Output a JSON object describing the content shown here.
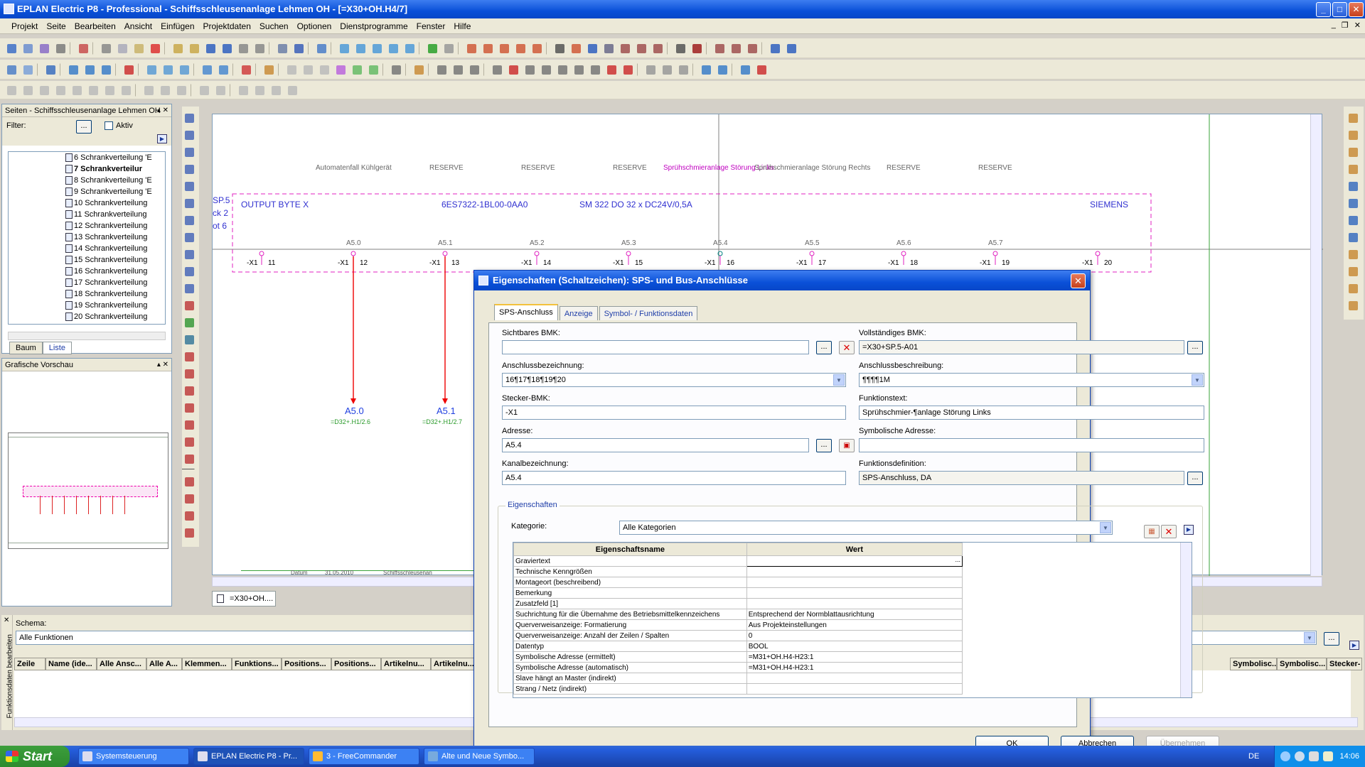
{
  "window": {
    "title": "EPLAN Electric P8 - Professional - Schiffsschleusenanlage Lehmen OH - [=X30+OH.H4/7]",
    "minimize": "_",
    "maximize": "□",
    "close": "✕"
  },
  "menu": [
    "Projekt",
    "Seite",
    "Bearbeiten",
    "Ansicht",
    "Einfügen",
    "Projektdaten",
    "Suchen",
    "Optionen",
    "Dienstprogramme",
    "Fenster",
    "Hilfe"
  ],
  "pages_panel": {
    "title": "Seiten - Schiffsschleusenanlage Lehmen OH",
    "filter_label": "Filter:",
    "filter_btn": "...",
    "aktiv_label": "Aktiv",
    "items": [
      "6 Schrankverteilung 'E",
      "7 Schrankverteilur",
      "8 Schrankverteilung 'E",
      "9 Schrankverteilung 'E",
      "10 Schrankverteilung",
      "11 Schrankverteilung",
      "12 Schrankverteilung",
      "13 Schrankverteilung",
      "14 Schrankverteilung",
      "15 Schrankverteilung",
      "16 Schrankverteilung",
      "17 Schrankverteilung",
      "18 Schrankverteilung",
      "19 Schrankverteilung",
      "20 Schrankverteilung"
    ],
    "tab_tree": "Baum",
    "tab_list": "Liste"
  },
  "preview_panel": {
    "title": "Grafische Vorschau"
  },
  "drawing": {
    "tab_label": "=X30+OH....",
    "top_labels": [
      "Automatenfall Kühlgerät",
      "RESERVE",
      "RESERVE",
      "RESERVE",
      "Sprühschmieranlage Störung Links",
      "Sprühschmieranlage Störung Rechts",
      "RESERVE",
      "RESERVE"
    ],
    "left_labels": [
      "SP.5",
      "ck 2",
      "ot 6"
    ],
    "box_texts": [
      "OUTPUT BYTE X",
      "6ES7322-1BL00-0AA0",
      "SM 322 DO 32 x DC24V/0,5A",
      "SIEMENS"
    ],
    "addresses": [
      "A5.0",
      "A5.1",
      "A5.2",
      "A5.3",
      "A5.4",
      "A5.5",
      "A5.6",
      "A5.7"
    ],
    "terminals": [
      "11",
      "12",
      "13",
      "14",
      "15",
      "16",
      "17",
      "18",
      "19",
      "20"
    ],
    "connector": "-X1",
    "out_labels": [
      {
        "addr": "A5.0",
        "ref": "=D32+.H1/2.6"
      },
      {
        "addr": "A5.1",
        "ref": "=D32+.H1/2.7"
      }
    ],
    "footer_date_label": "Datum",
    "footer_date": "31.05.2010",
    "footer_project": "Schiffsschleusenan"
  },
  "bottom": {
    "side_label": "Funktionsdaten bearbeiten",
    "schema_label": "Schema:",
    "schema_value": "Alle Funktionen",
    "columns": [
      "Zeile",
      "Name (ide...",
      "Alle Ansc...",
      "Alle A...",
      "Klemmen...",
      "Funktions...",
      "Positions...",
      "Positions...",
      "Artikelnu...",
      "Artikelnu..."
    ],
    "columns_right": [
      "Symbolisc...",
      "Symbolisc...",
      "Stecker-"
    ]
  },
  "dialog": {
    "title": "Eigenschaften (Schaltzeichen): SPS- und Bus-Anschlüsse",
    "tabs": [
      "SPS-Anschluss",
      "Anzeige",
      "Symbol- / Funktionsdaten"
    ],
    "fields": {
      "sichtbares_bmk_label": "Sichtbares BMK:",
      "sichtbares_bmk": "",
      "vollstaendiges_bmk_label": "Vollständiges BMK:",
      "vollstaendiges_bmk": "=X30+SP.5-A01",
      "anschlussbezeichnung_label": "Anschlussbezeichnung:",
      "anschlussbezeichnung": "16¶17¶18¶19¶20",
      "anschlussbeschreibung_label": "Anschlussbeschreibung:",
      "anschlussbeschreibung": "¶¶¶¶1M",
      "stecker_bmk_label": "Stecker-BMK:",
      "stecker_bmk": "-X1",
      "funktionstext_label": "Funktionstext:",
      "funktionstext": "Sprühschmier-¶anlage Störung Links",
      "adresse_label": "Adresse:",
      "adresse": "A5.4",
      "symbolische_adresse_label": "Symbolische Adresse:",
      "symbolische_adresse": "",
      "kanalbezeichnung_label": "Kanalbezeichnung:",
      "kanalbezeichnung": "A5.4",
      "funktionsdefinition_label": "Funktionsdefinition:",
      "funktionsdefinition": "SPS-Anschluss, DA"
    },
    "props_group": "Eigenschaften",
    "kategorie_label": "Kategorie:",
    "kategorie": "Alle Kategorien",
    "table_head": [
      "Eigenschaftsname",
      "Wert"
    ],
    "rows": [
      [
        "Graviertext",
        ""
      ],
      [
        "Technische Kenngrößen",
        ""
      ],
      [
        "Montageort (beschreibend)",
        ""
      ],
      [
        "Bemerkung",
        ""
      ],
      [
        "Zusatzfeld [1]",
        ""
      ],
      [
        "Suchrichtung für die Übernahme des Betriebsmittelkennzeichens",
        "Entsprechend der Normblattausrichtung"
      ],
      [
        "Querverweisanzeige: Formatierung",
        "Aus Projekteinstellungen"
      ],
      [
        "Querverweisanzeige: Anzahl der Zeilen / Spalten",
        "0"
      ],
      [
        "Datentyp",
        "BOOL"
      ],
      [
        "Symbolische Adresse (ermittelt)",
        "=M31+OH.H4-H23:1"
      ],
      [
        "Symbolische Adresse (automatisch)",
        "=M31+OH.H4-H23:1"
      ],
      [
        "Slave hängt an Master (indirekt)",
        ""
      ],
      [
        "Strang / Netz (indirekt)",
        ""
      ]
    ],
    "btn_ok": "OK",
    "btn_cancel": "Abbrechen",
    "btn_apply": "Übernehmen"
  },
  "taskbar": {
    "start": "Start",
    "tasks": [
      "Systemsteuerung",
      "EPLAN Electric P8 - Pr...",
      "3 - FreeCommander",
      "Alte und Neue Symbo..."
    ],
    "lang": "DE",
    "time": "14:06"
  }
}
